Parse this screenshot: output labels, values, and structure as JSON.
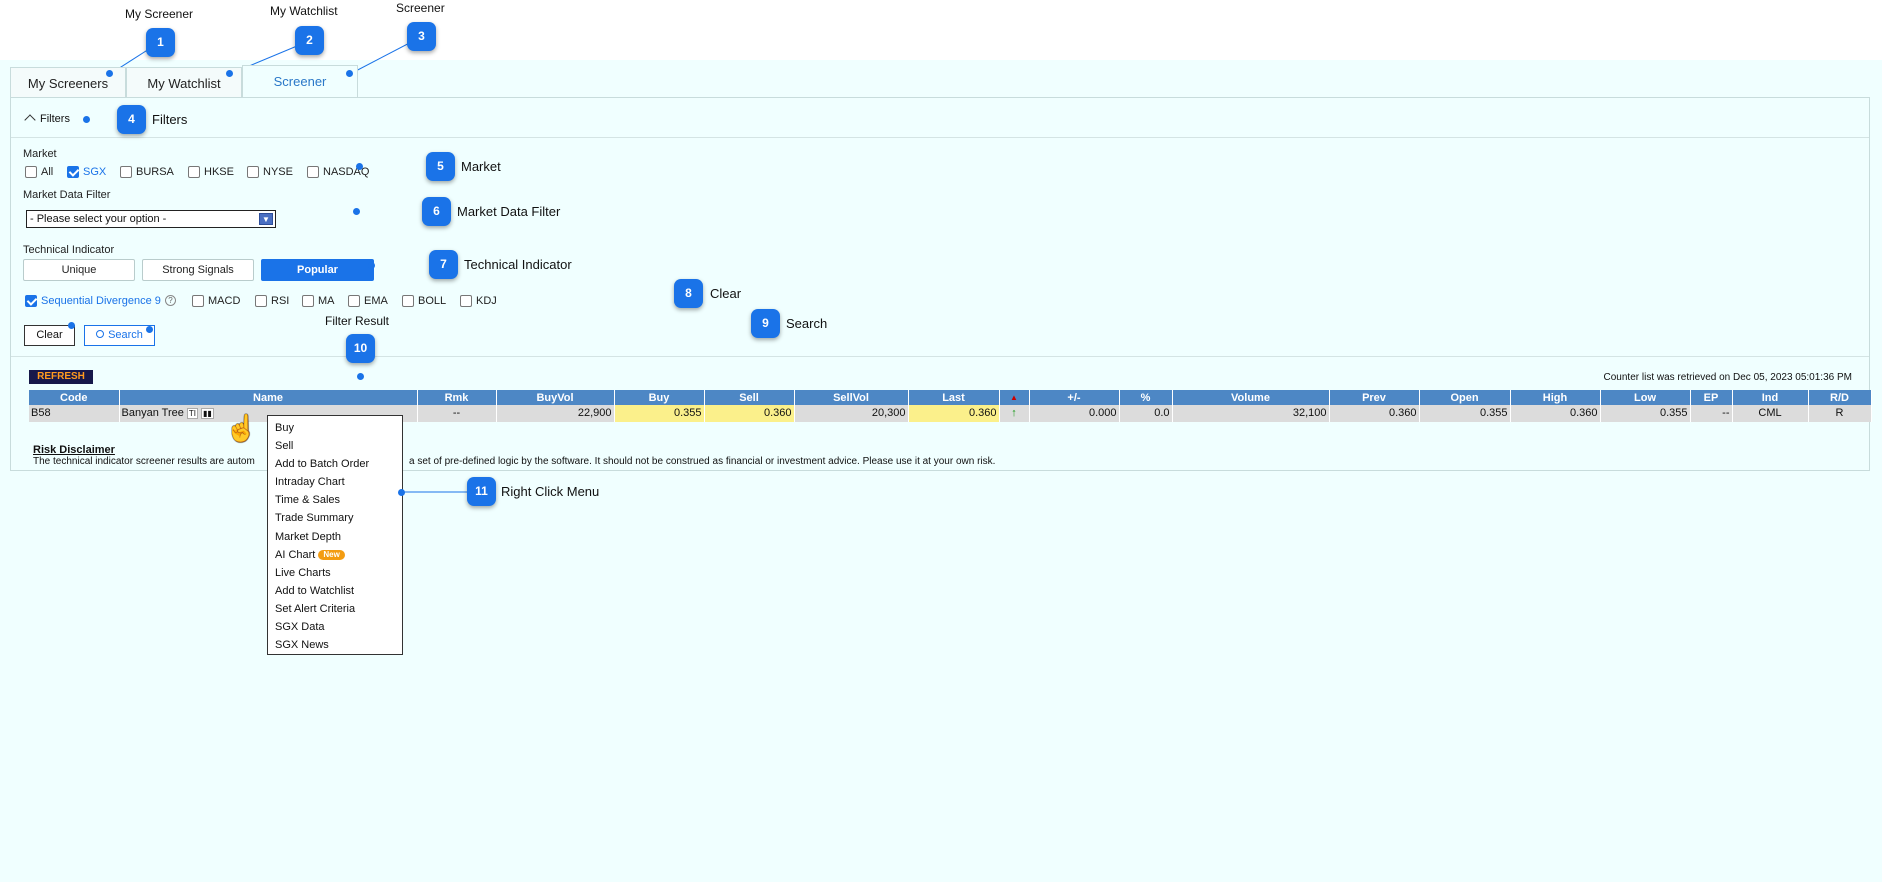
{
  "annotations": {
    "top_labels": [
      "My Screener",
      "My Watchlist",
      "Screener"
    ],
    "markers": [
      "1",
      "2",
      "3",
      "4",
      "5",
      "6",
      "7",
      "8",
      "9",
      "10",
      "11"
    ],
    "labels": {
      "filters": "Filters",
      "market": "Market",
      "market_data_filter": "Market Data Filter",
      "technical_indicator": "Technical Indicator",
      "clear": "Clear",
      "search": "Search",
      "filter_result": "Filter Result",
      "right_click_menu": "Right Click Menu"
    }
  },
  "tabs": [
    "My Screeners",
    "My Watchlist",
    "Screener"
  ],
  "filters": {
    "toggle_label": "Filters",
    "market_label": "Market",
    "markets": [
      {
        "label": "All",
        "checked": false
      },
      {
        "label": "SGX",
        "checked": true
      },
      {
        "label": "BURSA",
        "checked": false
      },
      {
        "label": "HKSE",
        "checked": false
      },
      {
        "label": "NYSE",
        "checked": false
      },
      {
        "label": "NASDAQ",
        "checked": false
      }
    ],
    "market_data_filter_label": "Market Data Filter",
    "market_data_filter_value": "- Please select your option -",
    "technical_indicator_label": "Technical Indicator",
    "indicator_tabs": [
      "Unique",
      "Strong Signals",
      "Popular"
    ],
    "indicators": [
      {
        "label": "Sequential Divergence 9",
        "checked": true
      },
      {
        "label": "MACD",
        "checked": false
      },
      {
        "label": "RSI",
        "checked": false
      },
      {
        "label": "MA",
        "checked": false
      },
      {
        "label": "EMA",
        "checked": false
      },
      {
        "label": "BOLL",
        "checked": false
      },
      {
        "label": "KDJ",
        "checked": false
      }
    ],
    "help_symbol": "?",
    "clear_label": "Clear",
    "search_label": "Search"
  },
  "results": {
    "refresh_label": "REFRESH",
    "retrieved_text": "Counter list was retrieved on Dec 05, 2023 05:01:36 PM",
    "columns": [
      "Code",
      "Name",
      "Rmk",
      "BuyVol",
      "Buy",
      "Sell",
      "SellVol",
      "Last",
      "",
      "+/-",
      "%",
      "Volume",
      "Prev",
      "Open",
      "High",
      "Low",
      "EP",
      "Ind",
      "R/D"
    ],
    "row": {
      "code": "B58",
      "name": "Banyan Tree",
      "name_tag": "TI",
      "rmk": "--",
      "buyvol": "22,900",
      "buy": "0.355",
      "sell": "0.360",
      "sellvol": "20,300",
      "last": "0.360",
      "arrow": "↑",
      "change": "0.000",
      "pct": "0.0",
      "volume": "32,100",
      "prev": "0.360",
      "open": "0.355",
      "high": "0.360",
      "low": "0.355",
      "ep": "--",
      "ind": "CML",
      "rd": "R"
    }
  },
  "context_menu": {
    "items": [
      "Buy",
      "Sell",
      "Add to Batch Order",
      "Intraday Chart",
      "Time & Sales",
      "Trade Summary",
      "Market Depth",
      "AI Chart",
      "Live Charts",
      "Add to Watchlist",
      "Set Alert Criteria",
      "SGX Data",
      "SGX News"
    ],
    "new_badge": "New"
  },
  "disclaimer": {
    "title": "Risk Disclaimer",
    "text": "The technical indicator screener results are autom",
    "text_tail": "a set of pre-defined logic by the software. It should not be construed as financial or investment advice. Please use it at your own risk."
  },
  "colors": {
    "accent": "#1a73e8",
    "header_blue": "#4d87c5",
    "highlight_yellow": "#fbf08b",
    "refresh_bg": "#17184a",
    "refresh_text": "#ff9a1f"
  }
}
